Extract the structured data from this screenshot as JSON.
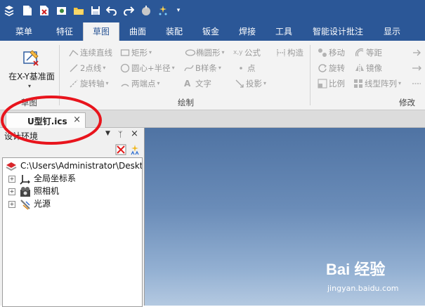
{
  "ribbon_tabs": [
    {
      "label": "菜单"
    },
    {
      "label": "特征"
    },
    {
      "label": "草图"
    },
    {
      "label": "曲面"
    },
    {
      "label": "装配"
    },
    {
      "label": "钣金"
    },
    {
      "label": "焊接"
    },
    {
      "label": "工具"
    },
    {
      "label": "智能设计批注"
    },
    {
      "label": "显示"
    }
  ],
  "active_tab": "草图",
  "sketch_group": {
    "main_button": "在X-Y基准面",
    "label": "草图"
  },
  "draw_group": {
    "label": "绘制",
    "items": {
      "polyline": "连续直线",
      "rectangle": "矩形",
      "ellipse": "椭圆形",
      "formula": "公式",
      "construct": "构造",
      "two_point_line": "2点线",
      "circle_center_radius": "圆心+半径",
      "bspline": "B样条",
      "point": "点",
      "rotation_axis": "旋转轴",
      "two_point_arc": "两端点",
      "text": "文字",
      "projection": "投影"
    }
  },
  "modify_group": {
    "label": "修改",
    "items": {
      "move": "移动",
      "equidistant": "等距",
      "rotate": "旋转",
      "mirror": "镜像",
      "scale": "比例",
      "linear_array": "线型阵列"
    }
  },
  "document_tab": {
    "label": "U型钉.ics",
    "close": "×"
  },
  "design_panel": {
    "title": "设计环境",
    "pin": "ᛉ",
    "close": "×",
    "tree": {
      "root": "C:\\Users\\Administrator\\Desktop",
      "children": [
        "全局坐标系",
        "照相机",
        "光源"
      ]
    }
  },
  "watermark": {
    "brand": "Bai 经验",
    "site": "jingyan.baidu.com"
  },
  "colors": {
    "title_bar": "#2b5797",
    "ribbon_bg": "#f3f3f3",
    "annotation": "#e8141c"
  }
}
